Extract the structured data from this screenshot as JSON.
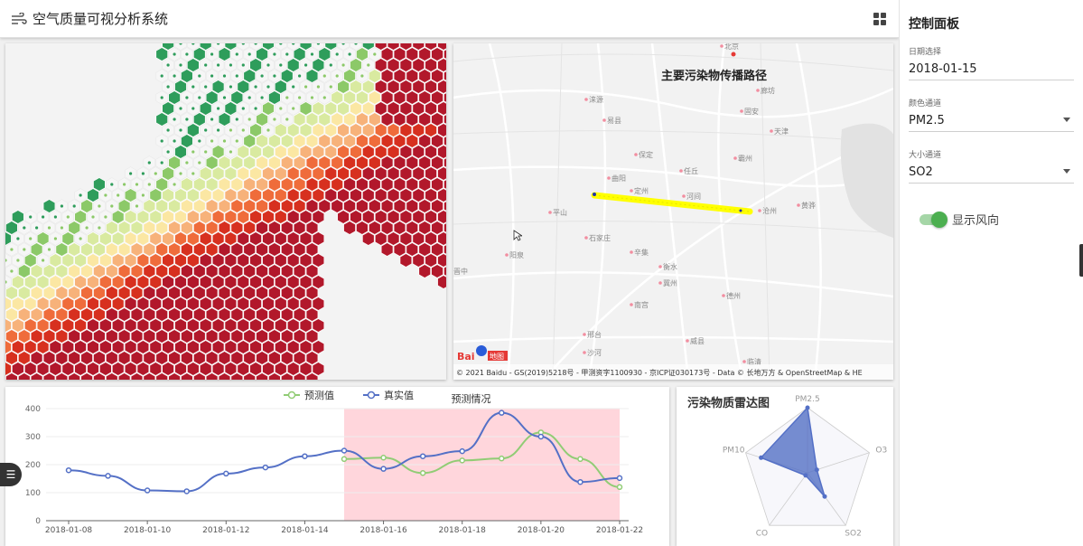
{
  "header": {
    "title": "空气质量可视分析系统"
  },
  "map": {
    "title": "主要污染物传播路径",
    "brand": "Bai",
    "brand_suffix": "地图",
    "copyright": "© 2021 Baidu - GS(2019)5218号 - 甲测资字1100930 - 京ICP证030173号 - Data © 长地万方 & OpenStreetMap & HE",
    "places": [
      "北京",
      "廊坊",
      "天津",
      "保定",
      "任丘",
      "定州",
      "河间",
      "沧州",
      "石家庄",
      "辛集",
      "衡水",
      "冀州",
      "德州",
      "南宫",
      "邢台",
      "沙河",
      "威县",
      "阳泉",
      "平山",
      "晋中",
      "临清",
      "黄骅",
      "固安",
      "霸州",
      "涞源",
      "易县",
      "曲阳"
    ]
  },
  "chart": {
    "title": "预测情况",
    "legend": [
      "预测值",
      "真实值"
    ]
  },
  "chart_data": [
    {
      "type": "line",
      "title": "预测情况",
      "x": [
        "2018-01-08",
        "2018-01-09",
        "2018-01-10",
        "2018-01-11",
        "2018-01-12",
        "2018-01-13",
        "2018-01-14",
        "2018-01-15",
        "2018-01-16",
        "2018-01-17",
        "2018-01-18",
        "2018-01-19",
        "2018-01-20",
        "2018-01-21",
        "2018-01-22"
      ],
      "xticks": [
        "2018-01-08",
        "2018-01-10",
        "2018-01-12",
        "2018-01-14",
        "2018-01-16",
        "2018-01-18",
        "2018-01-20",
        "2018-01-22"
      ],
      "ylim": [
        0,
        400
      ],
      "yticks": [
        "0",
        "100",
        "200",
        "300",
        "400"
      ],
      "highlight_range": [
        "2018-01-15",
        "2018-01-22"
      ],
      "series": [
        {
          "name": "预测值",
          "color": "#91cc75",
          "values": [
            null,
            null,
            null,
            null,
            null,
            null,
            null,
            220,
            225,
            170,
            215,
            222,
            315,
            220,
            120
          ]
        },
        {
          "name": "真实值",
          "color": "#5470c6",
          "values": [
            180,
            160,
            108,
            105,
            168,
            190,
            230,
            250,
            185,
            230,
            248,
            385,
            300,
            138,
            152
          ]
        }
      ]
    },
    {
      "type": "radar",
      "title": "污染物质雷达图",
      "indicators": [
        "PM2.5",
        "O3",
        "SO2",
        "CO",
        "PM10"
      ],
      "max": 100,
      "values": [
        100,
        15,
        45,
        5,
        75
      ],
      "color": "#5470c6"
    }
  ],
  "sidebar": {
    "title": "控制面板",
    "date_label": "日期选择",
    "date_value": "2018-01-15",
    "color_label": "颜色通道",
    "color_value": "PM2.5",
    "size_label": "大小通道",
    "size_value": "SO2",
    "wind_label": "显示风向"
  },
  "colors": {
    "accent": "#4caf50",
    "highlight": "#ffd6dc",
    "path": "#ffff00"
  }
}
